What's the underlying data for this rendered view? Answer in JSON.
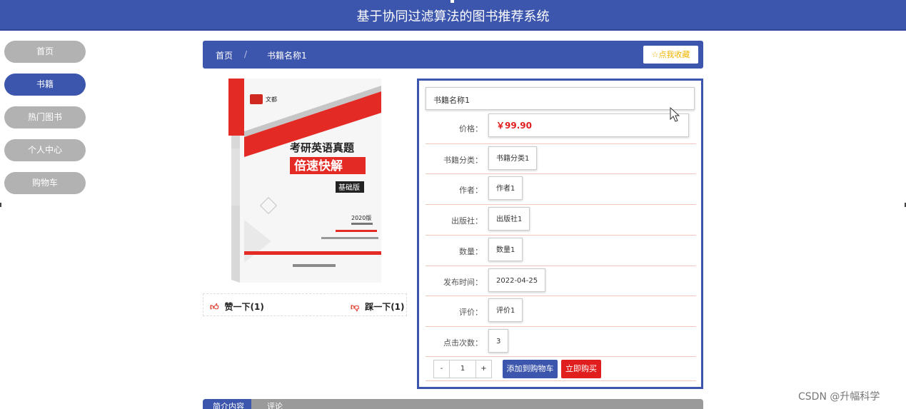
{
  "header": {
    "title": "基于协同过滤算法的图书推荐系统"
  },
  "sidebar": {
    "items": [
      {
        "label": "首页"
      },
      {
        "label": "书籍"
      },
      {
        "label": "热门图书"
      },
      {
        "label": "个人中心"
      },
      {
        "label": "购物车"
      }
    ]
  },
  "breadcrumb": {
    "home": "首页",
    "separator": "/",
    "current": "书籍名称1"
  },
  "favorite": {
    "icon": "star-icon",
    "label": "点我收藏"
  },
  "cover": {
    "publisher_logo": "文都",
    "title_line1": "考研英语真题",
    "title_line2": "倍速快解",
    "edition": "基础版",
    "spine": "考研英语真题",
    "year": "2020版"
  },
  "likes": {
    "like_label": "赞一下(1)",
    "dislike_label": "踩一下(1)"
  },
  "book": {
    "name": "书籍名称1",
    "price_label": "价格：",
    "price": "￥99.90",
    "category_label": "书籍分类：",
    "category": "书籍分类1",
    "author_label": "作者：",
    "author": "作者1",
    "publisher_label": "出版社：",
    "publisher": "出版社1",
    "quantity_label": "数量：",
    "quantity": "数量1",
    "date_label": "发布时间：",
    "date": "2022-04-25",
    "rating_label": "评价：",
    "rating": "评价1",
    "clicks_label": "点击次数：",
    "clicks": "3"
  },
  "actions": {
    "minus": "-",
    "qty": "1",
    "plus": "+",
    "add_cart": "添加到购物车",
    "buy_now": "立即购买"
  },
  "tabs": [
    {
      "label": "简介内容"
    },
    {
      "label": "评论"
    }
  ],
  "watermark": "CSDN @升幅科学",
  "colors": {
    "primary": "#3d56ad",
    "danger": "#e01e1e",
    "sidebar_inactive": "#b2b2b2"
  }
}
